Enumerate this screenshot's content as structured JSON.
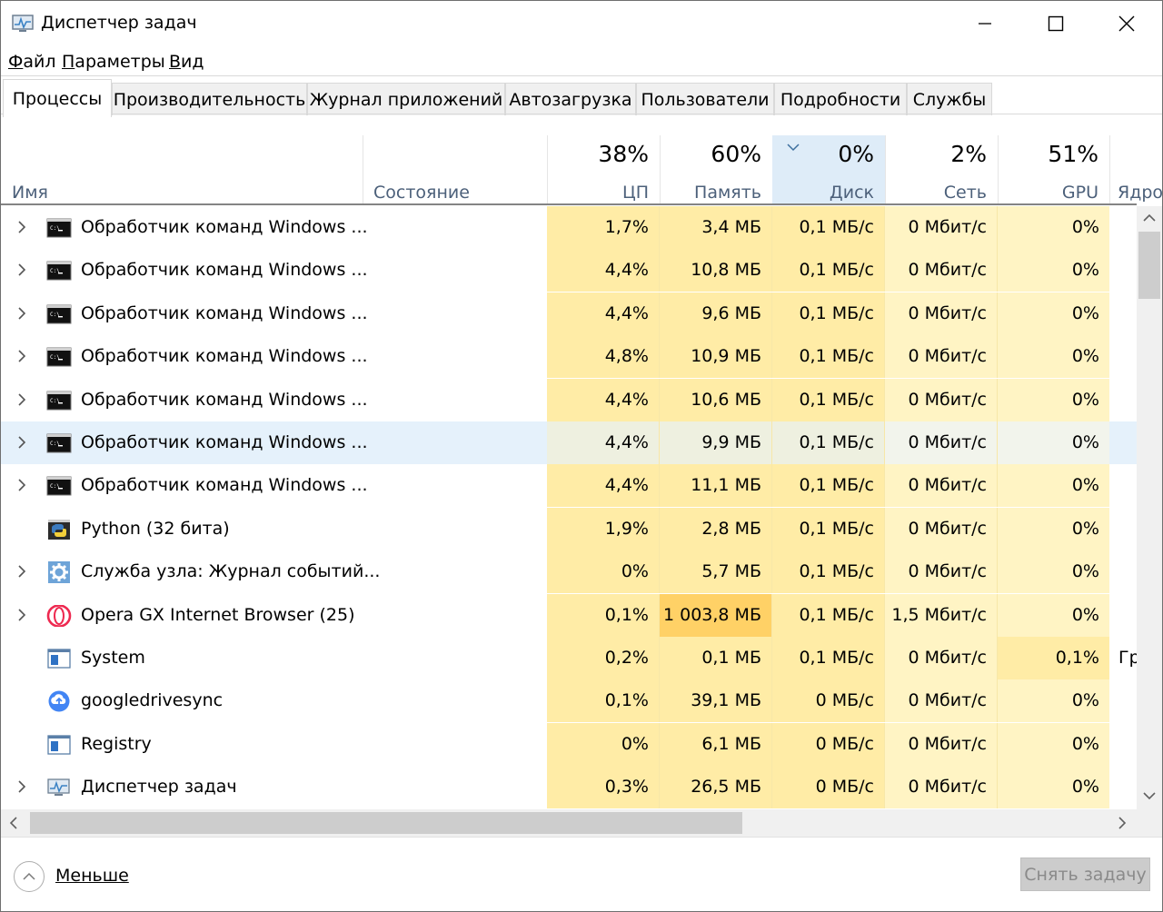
{
  "window": {
    "title": "Диспетчер задач"
  },
  "menu": [
    {
      "accel": "Ф",
      "rest": "айл"
    },
    {
      "accel": "П",
      "rest": "араметры"
    },
    {
      "accel": "В",
      "rest": "ид"
    }
  ],
  "tabs": [
    "Процессы",
    "Производительность",
    "Журнал приложений",
    "Автозагрузка",
    "Пользователи",
    "Подробности",
    "Службы"
  ],
  "header": {
    "name": "Имя",
    "status": "Состояние",
    "cpu": {
      "pct": "38%",
      "label": "ЦП"
    },
    "memory": {
      "pct": "60%",
      "label": "Память"
    },
    "disk": {
      "pct": "0%",
      "label": "Диск"
    },
    "network": {
      "pct": "2%",
      "label": "Сеть"
    },
    "gpu": {
      "pct": "51%",
      "label": "GPU"
    },
    "gpu_engine": "Ядро"
  },
  "processes": [
    {
      "name": "Обработчик команд Windows ...",
      "icon": "cmd-icon",
      "expandable": true,
      "cpu": "1,7%",
      "mem": "3,4 МБ",
      "disk": "0,1 МБ/с",
      "net": "0 Мбит/с",
      "gpu": "0%",
      "extra": ""
    },
    {
      "name": "Обработчик команд Windows ...",
      "icon": "cmd-icon",
      "expandable": true,
      "cpu": "4,4%",
      "mem": "10,8 МБ",
      "disk": "0,1 МБ/с",
      "net": "0 Мбит/с",
      "gpu": "0%",
      "extra": ""
    },
    {
      "name": "Обработчик команд Windows ...",
      "icon": "cmd-icon",
      "expandable": true,
      "cpu": "4,4%",
      "mem": "9,6 МБ",
      "disk": "0,1 МБ/с",
      "net": "0 Мбит/с",
      "gpu": "0%",
      "extra": ""
    },
    {
      "name": "Обработчик команд Windows ...",
      "icon": "cmd-icon",
      "expandable": true,
      "cpu": "4,8%",
      "mem": "10,9 МБ",
      "disk": "0,1 МБ/с",
      "net": "0 Мбит/с",
      "gpu": "0%",
      "extra": ""
    },
    {
      "name": "Обработчик команд Windows ...",
      "icon": "cmd-icon",
      "expandable": true,
      "cpu": "4,4%",
      "mem": "10,6 МБ",
      "disk": "0,1 МБ/с",
      "net": "0 Мбит/с",
      "gpu": "0%",
      "extra": ""
    },
    {
      "name": "Обработчик команд Windows ...",
      "icon": "cmd-icon",
      "expandable": true,
      "cpu": "4,4%",
      "mem": "9,9 МБ",
      "disk": "0,1 МБ/с",
      "net": "0 Мбит/с",
      "gpu": "0%",
      "extra": ""
    },
    {
      "name": "Обработчик команд Windows ...",
      "icon": "cmd-icon",
      "expandable": true,
      "cpu": "4,4%",
      "mem": "11,1 МБ",
      "disk": "0,1 МБ/с",
      "net": "0 Мбит/с",
      "gpu": "0%",
      "extra": ""
    },
    {
      "name": "Python (32 бита)",
      "icon": "python-icon",
      "expandable": false,
      "cpu": "1,9%",
      "mem": "2,8 МБ",
      "disk": "0,1 МБ/с",
      "net": "0 Мбит/с",
      "gpu": "0%",
      "extra": ""
    },
    {
      "name": "Служба узла: Журнал событий...",
      "icon": "service-gear-icon",
      "expandable": true,
      "cpu": "0%",
      "mem": "5,7 МБ",
      "disk": "0,1 МБ/с",
      "net": "0 Мбит/с",
      "gpu": "0%",
      "extra": ""
    },
    {
      "name": "Opera GX Internet Browser (25)",
      "icon": "opera-gx-icon",
      "expandable": true,
      "cpu": "0,1%",
      "mem": "1 003,8 МБ",
      "disk": "0,1 МБ/с",
      "net": "1,5 Мбит/с",
      "gpu": "0%",
      "extra": ""
    },
    {
      "name": "System",
      "icon": "system-window-icon",
      "expandable": false,
      "cpu": "0,2%",
      "mem": "0,1 МБ",
      "disk": "0,1 МБ/с",
      "net": "0 Мбит/с",
      "gpu": "0,1%",
      "extra": "Гр"
    },
    {
      "name": "googledrivesync",
      "icon": "google-drive-sync-icon",
      "expandable": false,
      "cpu": "0,1%",
      "mem": "39,1 МБ",
      "disk": "0 МБ/с",
      "net": "0 Мбит/с",
      "gpu": "0%",
      "extra": ""
    },
    {
      "name": "Registry",
      "icon": "registry-window-icon",
      "expandable": false,
      "cpu": "0%",
      "mem": "6,1 МБ",
      "disk": "0 МБ/с",
      "net": "0 Мбит/с",
      "gpu": "0%",
      "extra": ""
    },
    {
      "name": "Диспетчер задач",
      "icon": "task-manager-icon",
      "expandable": true,
      "cpu": "0,3%",
      "mem": "26,5 МБ",
      "disk": "0 МБ/с",
      "net": "0 Мбит/с",
      "gpu": "0%",
      "extra": ""
    }
  ],
  "colors": {
    "heat_light": "#fff4c4",
    "heat_mid": "#ffeca6",
    "heat_high": "#ffd166",
    "selected_row": "#e5f1fb",
    "sorted_header": "#deecf8",
    "header_label": "#4c607a"
  },
  "footer": {
    "less_label": "Меньше",
    "end_task_label": "Снять задачу"
  }
}
